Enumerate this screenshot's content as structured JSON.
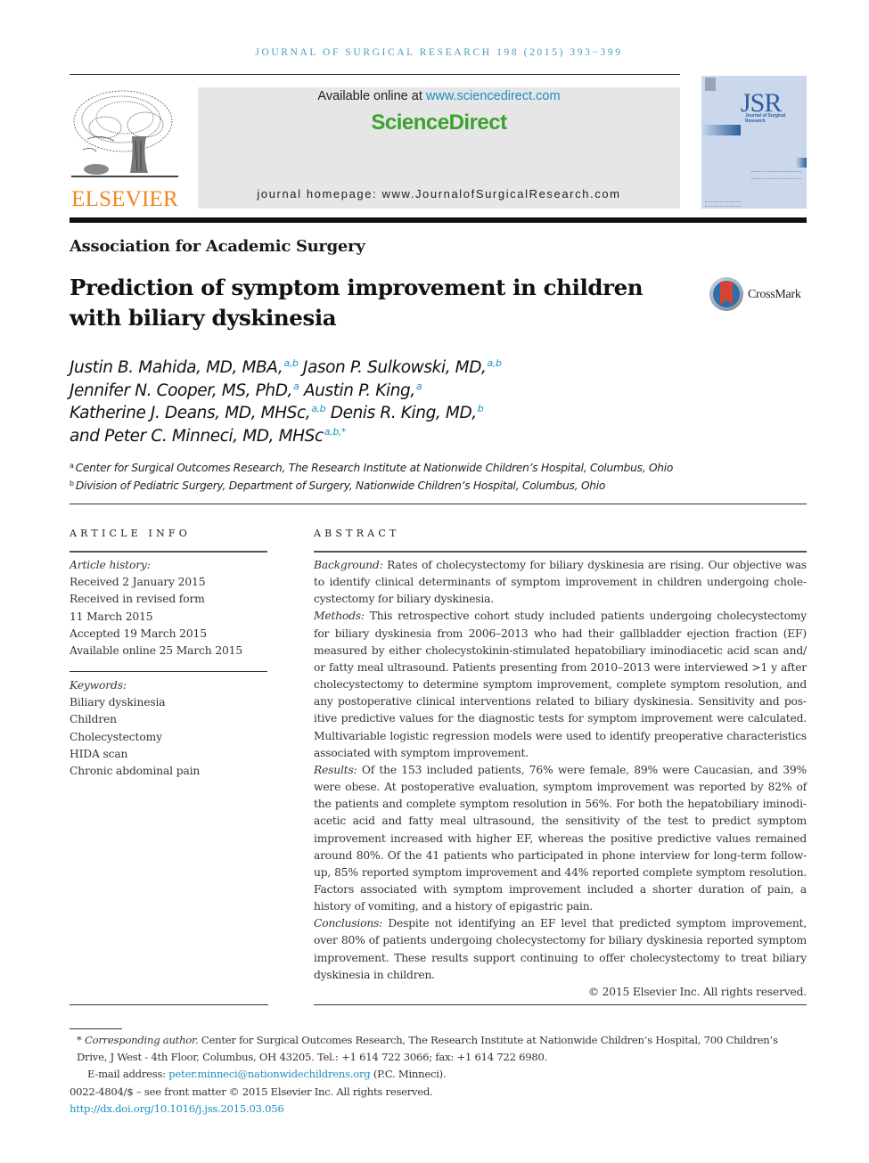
{
  "running_head": "JOURNAL OF SURGICAL RESEARCH 198 (2015) 393−399",
  "header": {
    "publisher_logo_text": "ELSEVIER",
    "available_online_prefix": "Available online at ",
    "available_online_link": "www.sciencedirect.com",
    "brand": "ScienceDirect",
    "homepage": "journal homepage: www.JournalofSurgicalResearch.com",
    "cover": {
      "letters": "JSR",
      "subtitle": "Journal of Surgical Research"
    },
    "colors": {
      "elsevier_orange": "#f0861f",
      "sciencedirect_green": "#3aa22f",
      "link_blue": "#1a8fc2",
      "cover_blue": "#2b5f9e"
    }
  },
  "section_label": "Association for Academic Surgery",
  "title": "Prediction of symptom improvement in children with biliary dyskinesia",
  "crossmark_label": "CrossMark",
  "authors": [
    {
      "name": "Justin B. Mahida, MD, MBA,",
      "affil": "a,b"
    },
    {
      "name": "Jason P. Sulkowski, MD,",
      "affil": "a,b"
    },
    {
      "name": "Jennifer N. Cooper, MS, PhD,",
      "affil": "a"
    },
    {
      "name": "Austin P. King,",
      "affil": "a"
    },
    {
      "name": "Katherine J. Deans, MD, MHSc,",
      "affil": "a,b"
    },
    {
      "name": "Denis R. King, MD,",
      "affil": "b"
    },
    {
      "name": "and Peter C. Minneci, MD, MHSc",
      "affil": "a,b,*"
    }
  ],
  "affiliations": [
    {
      "mark": "a",
      "text": "Center for Surgical Outcomes Research, The Research Institute at Nationwide Children’s Hospital, Columbus, Ohio"
    },
    {
      "mark": "b",
      "text": "Division of Pediatric Surgery, Department of Surgery, Nationwide Children’s Hospital, Columbus, Ohio"
    }
  ],
  "article_info": {
    "heading": "ARTICLE INFO",
    "history_label": "Article history:",
    "history": [
      "Received 2 January 2015",
      "Received in revised form",
      "11 March 2015",
      "Accepted 19 March 2015",
      "Available online 25 March 2015"
    ],
    "keywords_label": "Keywords:",
    "keywords": [
      "Biliary dyskinesia",
      "Children",
      "Cholecystectomy",
      "HIDA scan",
      "Chronic abdominal pain"
    ]
  },
  "abstract": {
    "heading": "ABSTRACT",
    "sections": [
      {
        "label": "Background:",
        "text": " Rates of cholecystectomy for biliary dyskinesia are rising. Our objective was to identify clinical determinants of symptom improvement in children undergoing chole­cystectomy for biliary dyskinesia."
      },
      {
        "label": "Methods:",
        "text": " This retrospective cohort study included patients undergoing cholecystectomy for biliary dyskinesia from 2006–2013 who had their gallbladder ejection fraction (EF) measured by either cholecystokinin-stimulated hepatobiliary iminodiacetic acid scan and/​or fatty meal ultrasound. Patients presenting from 2010–2013 were interviewed >1 y after cholecystectomy to determine symptom improvement, complete symptom resolution, and any postoperative clinical interventions related to biliary dyskinesia. Sensitivity and pos­itive predictive values for the diagnostic tests for symptom improvement were calculated. Multivariable logistic regression models were used to identify preoperative characteristics associated with symptom improvement."
      },
      {
        "label": "Results:",
        "text": " Of the 153 included patients, 76% were female, 89% were Caucasian, and 39% were obese. At postoperative evaluation, symptom improvement was reported by 82% of the patients and complete symptom resolution in 56%. For both the hepatobiliary iminodi­acetic acid and fatty meal ultrasound, the sensitivity of the test to predict symptom improvement increased with higher EF, whereas the positive predictive values remained around 80%. Of the 41 patients who participated in phone interview for long-term follow-up, 85% reported symptom improvement and 44% reported complete symptom resolution. Factors associated with symptom improvement included a shorter duration of pain, a history of vomiting, and a history of epigastric pain."
      },
      {
        "label": "Conclusions:",
        "text": " Despite not identifying an EF level that predicted symptom improvement, over 80% of patients undergoing cholecystectomy for biliary dyskinesia reported symptom improvement. These results support continuing to offer cholecystectomy to treat biliary dyskinesia in children."
      }
    ],
    "copyright": "© 2015 Elsevier Inc. All rights reserved."
  },
  "footnotes": {
    "corresponding_mark": "*",
    "corresponding_label": "Corresponding author.",
    "corresponding_text": " Center for Surgical Outcomes Research, The Research Institute at Nationwide Children’s Hospital, 700 Children’s Drive, J West - 4th Floor, Columbus, OH 43205. Tel.: +1 614 722 3066; fax: +1 614 722 6980.",
    "email_label": "E-mail address: ",
    "email": "peter.minneci@nationwidechildrens.org",
    "email_suffix": " (P.C. Minneci).",
    "front_matter": "0022-4804/$ – see front matter © 2015 Elsevier Inc. All rights reserved.",
    "doi": "http://dx.doi.org/10.1016/j.jss.2015.03.056"
  }
}
